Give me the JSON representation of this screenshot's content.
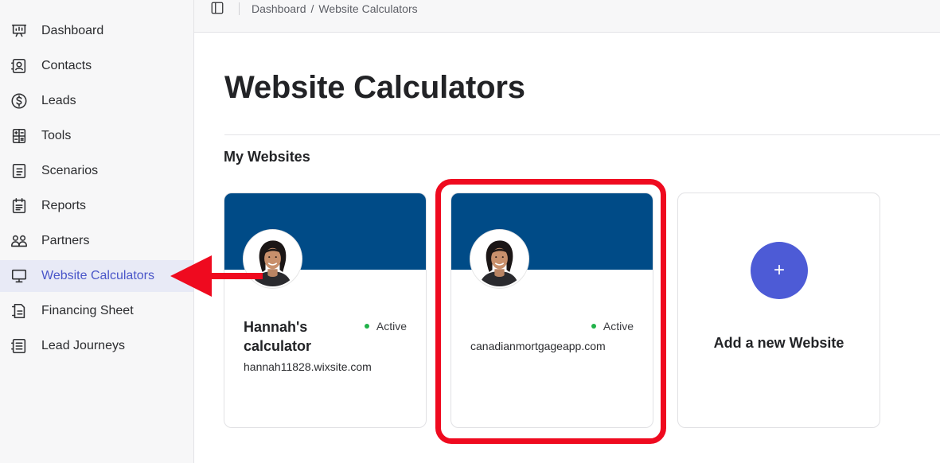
{
  "sidebar": {
    "items": [
      {
        "label": "Dashboard",
        "icon": "dashboard-icon"
      },
      {
        "label": "Contacts",
        "icon": "contacts-icon"
      },
      {
        "label": "Leads",
        "icon": "dollar-icon"
      },
      {
        "label": "Tools",
        "icon": "calculator-icon"
      },
      {
        "label": "Scenarios",
        "icon": "scenarios-icon"
      },
      {
        "label": "Reports",
        "icon": "reports-icon"
      },
      {
        "label": "Partners",
        "icon": "partners-icon"
      },
      {
        "label": "Website Calculators",
        "icon": "monitor-icon",
        "active": true
      },
      {
        "label": "Financing Sheet",
        "icon": "financing-sheet-icon"
      },
      {
        "label": "Lead Journeys",
        "icon": "lead-journeys-icon"
      }
    ]
  },
  "topbar": {
    "breadcrumb": [
      "Dashboard",
      "/",
      "Website Calculators"
    ]
  },
  "page": {
    "title": "Website Calculators",
    "section_title": "My Websites"
  },
  "cards": [
    {
      "name": "Hannah's calculator",
      "status": "Active",
      "domain": "hannah11828.wixsite.com"
    },
    {
      "name": "",
      "status": "Active",
      "domain": "canadianmortgageapp.com"
    }
  ],
  "add_card": {
    "label": "Add a new Website",
    "icon": "+"
  },
  "colors": {
    "banner": "#004b87",
    "accent": "#4d5bd6",
    "active_status": "#21b24a",
    "annotation": "#ef0a1f"
  }
}
